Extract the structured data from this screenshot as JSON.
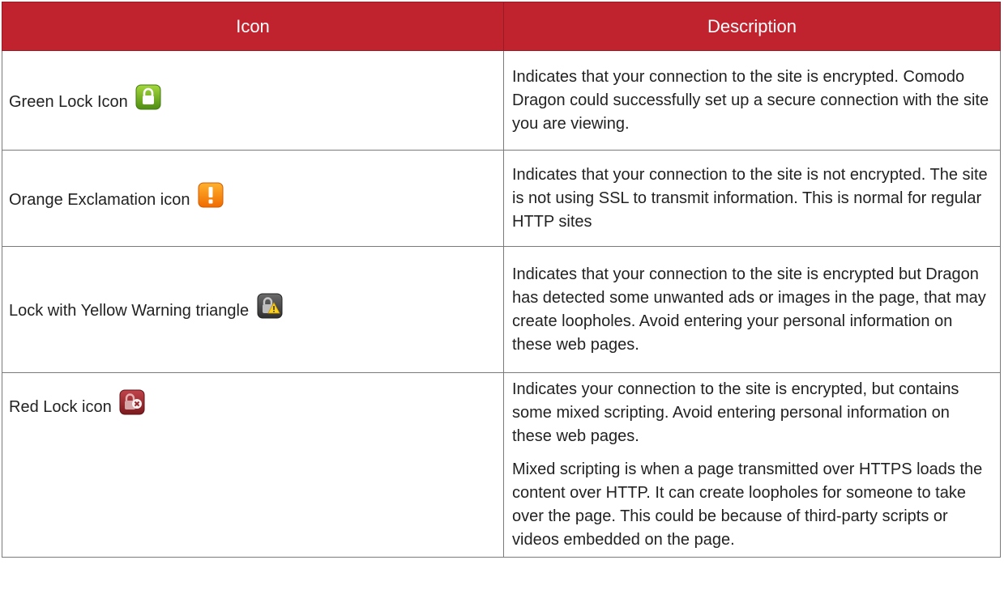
{
  "table": {
    "headers": [
      "Icon",
      "Description"
    ],
    "rows": [
      {
        "icon_label": "Green Lock Icon",
        "icon": "green-lock-icon",
        "description": [
          "Indicates that your connection to the site is encrypted. Comodo Dragon could successfully set up a secure connection with the site you are viewing."
        ]
      },
      {
        "icon_label": "Orange Exclamation icon",
        "icon": "orange-exclamation-icon",
        "description": [
          "Indicates that your connection to the site is not encrypted. The site is not using SSL to transmit information. This is normal for regular HTTP sites"
        ]
      },
      {
        "icon_label": "Lock with Yellow Warning triangle",
        "icon": "lock-warning-triangle-icon",
        "description": [
          "Indicates that your connection to the site is encrypted but Dragon has detected some unwanted ads or images in the page, that may create loopholes. Avoid entering your personal information on these web pages."
        ]
      },
      {
        "icon_label": "Red Lock icon",
        "icon": "red-lock-icon",
        "description": [
          "Indicates your connection to the site is encrypted, but contains some mixed scripting. Avoid entering personal information on these web pages.",
          "Mixed scripting is when a page transmitted over HTTPS loads the content over HTTP. It can create loopholes for someone to take over the page. This could be because of third-party scripts or videos embedded on the page."
        ]
      }
    ]
  },
  "colors": {
    "header_bg": "#c0222e",
    "header_text": "#ffffff",
    "border": "#7a7a7a"
  }
}
